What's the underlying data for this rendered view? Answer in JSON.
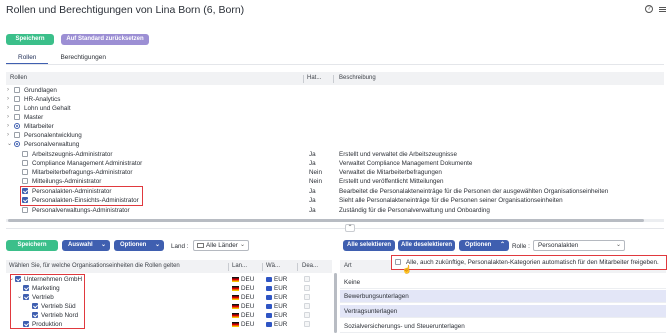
{
  "page": {
    "title": "Rollen und Berechtigungen von Lina Born (6, Born)"
  },
  "top": {
    "help_label": "?"
  },
  "toolbar": {
    "save_label": "Speichern",
    "reset_label": "Auf Standard zurücksetzen"
  },
  "tabs": [
    {
      "label": "Rollen",
      "active": true
    },
    {
      "label": "Berechtigungen",
      "active": false
    }
  ],
  "roles_table": {
    "headers": {
      "name": "Rollen",
      "hat": "Hat...",
      "desc": "Beschreibung"
    },
    "groups": [
      {
        "label": "Grundlagen",
        "expanded": false,
        "state": "empty"
      },
      {
        "label": "HR-Analytics",
        "expanded": false,
        "state": "empty"
      },
      {
        "label": "Lohn und Gehalt",
        "expanded": false,
        "state": "empty"
      },
      {
        "label": "Master",
        "expanded": false,
        "state": "empty"
      },
      {
        "label": "Mitarbeiter",
        "expanded": false,
        "state": "partial"
      },
      {
        "label": "Personalentwicklung",
        "expanded": false,
        "state": "empty"
      },
      {
        "label": "Personalverwaltung",
        "expanded": true,
        "state": "partial"
      }
    ],
    "children": [
      {
        "label": "Arbeitszeugnis-Administrator",
        "checked": false,
        "hat": "Ja",
        "desc": "Erstellt und verwaltet die Arbeitszeugnisse"
      },
      {
        "label": "Compliance Management Administrator",
        "checked": false,
        "hat": "Ja",
        "desc": "Verwaltet Compliance Management Dokumente"
      },
      {
        "label": "Mitarbeiterbefragungs-Administrator",
        "checked": false,
        "hat": "Nein",
        "desc": "Verwaltet die Mitarbeiterbefragungen"
      },
      {
        "label": "Mitteilungs-Administrator",
        "checked": false,
        "hat": "Nein",
        "desc": "Erstellt und veröffentlicht Mitteilungen"
      },
      {
        "label": "Personalakten-Administrator",
        "checked": true,
        "hat": "Ja",
        "desc": "Bearbeitet die Personalakteneinträge für die Personen der ausgewählten Organisationseinheiten"
      },
      {
        "label": "Personalakten-Einsichts-Administrator",
        "checked": true,
        "hat": "Ja",
        "desc": "Sieht alle Personalakteneinträge für die Personen seiner Organisationseinheiten"
      },
      {
        "label": "Personalverwaltungs-Administrator",
        "checked": false,
        "hat": "Ja",
        "desc": "Zuständig für die Personalverwaltung und Onboarding"
      }
    ]
  },
  "splitter": {
    "icon_label": "⌃"
  },
  "lower_left": {
    "save_label": "Speichern",
    "select_label": "Auswahl",
    "options_label": "Optionen",
    "land_label": "Land :",
    "land_value": "Alle Länder",
    "headers": {
      "name": "Wählen Sie, für welche Organisationseinheiten die Rollen gelten",
      "lang": "Lan...",
      "curr": "Wä...",
      "dea": "Dea..."
    },
    "units": [
      {
        "label": "Unternehmen GmbH",
        "lang": "DEU",
        "curr": "EUR"
      },
      {
        "label": "Marketing",
        "lang": "DEU",
        "curr": "EUR"
      },
      {
        "label": "Vertrieb",
        "lang": "DEU",
        "curr": "EUR"
      },
      {
        "label": "Vertrieb Süd",
        "lang": "DEU",
        "curr": "EUR"
      },
      {
        "label": "Vertrieb Nord",
        "lang": "DEU",
        "curr": "EUR"
      },
      {
        "label": "Produktion",
        "lang": "DEU",
        "curr": "EUR"
      }
    ]
  },
  "lower_right": {
    "select_all_label": "Alle selektieren",
    "deselect_all_label": "Alle deselektieren",
    "options_label": "Optionen",
    "role_label": "Rolle :",
    "role_value": "Personalakten",
    "header_art": "Art",
    "auto_assign_label": "Alle, auch zukünftige, Personalakten-Kategorien automatisch für den Mitarbeiter freigeben.",
    "categories": [
      {
        "label": "Keine",
        "selected": false
      },
      {
        "label": "Bewerbungsunterlagen",
        "selected": true
      },
      {
        "label": "Vertragsunterlagen",
        "selected": true
      },
      {
        "label": "Sozialversicherungs- und Steuerunterlagen",
        "selected": false
      }
    ]
  },
  "colors": {
    "accent": "#3f5fb0",
    "save_green": "#3bbf8a",
    "reset_purple": "#9c8fd4",
    "highlight_red": "#e0393e"
  }
}
